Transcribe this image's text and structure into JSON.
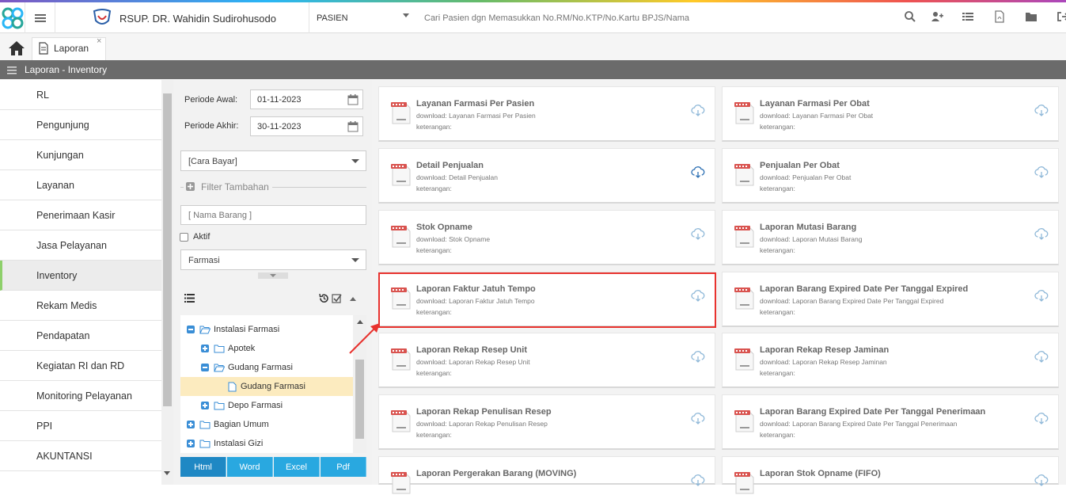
{
  "app": {
    "hospital_name": "RSUP. DR. Wahidin Sudirohusodo"
  },
  "search": {
    "category": "PASIEN",
    "placeholder": "Cari Pasien dgn Memasukkan No.RM/No.KTP/No.Kartu BPJS/Nama"
  },
  "tabs": [
    {
      "label": "Laporan",
      "close": "×"
    }
  ],
  "header": {
    "title": "Laporan - Inventory"
  },
  "sidebar": {
    "items": [
      {
        "label": "RL"
      },
      {
        "label": "Pengunjung"
      },
      {
        "label": "Kunjungan"
      },
      {
        "label": "Layanan"
      },
      {
        "label": "Penerimaan Kasir"
      },
      {
        "label": "Jasa Pelayanan"
      },
      {
        "label": "Inventory"
      },
      {
        "label": "Rekam Medis"
      },
      {
        "label": "Pendapatan"
      },
      {
        "label": "Kegiatan RI dan RD"
      },
      {
        "label": "Monitoring Pelayanan"
      },
      {
        "label": "PPI"
      },
      {
        "label": "AKUNTANSI"
      }
    ]
  },
  "filters": {
    "periode_awal_label": "Periode Awal:",
    "periode_awal_value": "01-11-2023",
    "periode_akhir_label": "Periode Akhir:",
    "periode_akhir_value": "30-11-2023",
    "cara_bayar": "[Cara Bayar]",
    "filter_tambahan": "Filter Tambahan",
    "nama_barang_placeholder": "[ Nama Barang ]",
    "aktif_label": "Aktif",
    "depo": "Farmasi"
  },
  "tree": [
    {
      "label": "Instalasi Farmasi"
    },
    {
      "label": "Apotek"
    },
    {
      "label": "Gudang Farmasi"
    },
    {
      "label": "Gudang Farmasi"
    },
    {
      "label": "Depo Farmasi"
    },
    {
      "label": "Bagian Umum"
    },
    {
      "label": "Instalasi Gizi"
    }
  ],
  "export_buttons": [
    {
      "label": "Html"
    },
    {
      "label": "Word"
    },
    {
      "label": "Excel"
    },
    {
      "label": "Pdf"
    }
  ],
  "reports": [
    {
      "title": "Layanan Farmasi Per Pasien",
      "download": "download: Layanan Farmasi Per Pasien",
      "ket": "keterangan:"
    },
    {
      "title": "Layanan Farmasi Per Obat",
      "download": "download: Layanan Farmasi Per Obat",
      "ket": "keterangan:"
    },
    {
      "title": "Detail Penjualan",
      "download": "download: Detail Penjualan",
      "ket": "keterangan:"
    },
    {
      "title": "Penjualan Per Obat",
      "download": "download: Penjualan Per Obat",
      "ket": "keterangan:"
    },
    {
      "title": "Stok Opname",
      "download": "download: Stok Opname",
      "ket": "keterangan:"
    },
    {
      "title": "Laporan Mutasi Barang",
      "download": "download: Laporan Mutasi Barang",
      "ket": "keterangan:"
    },
    {
      "title": "Laporan Faktur Jatuh Tempo",
      "download": "download: Laporan Faktur Jatuh Tempo",
      "ket": "keterangan:"
    },
    {
      "title": "Laporan Barang Expired Date Per Tanggal Expired",
      "download": "download: Laporan Barang Expired Date Per Tanggal Expired",
      "ket": "keterangan:"
    },
    {
      "title": "Laporan Rekap Resep Unit",
      "download": "download: Laporan Rekap Resep Unit",
      "ket": "keterangan:"
    },
    {
      "title": "Laporan Rekap Resep Jaminan",
      "download": "download: Laporan Rekap Resep Jaminan",
      "ket": "keterangan:"
    },
    {
      "title": "Laporan Rekap Penulisan Resep",
      "download": "download: Laporan Rekap Penulisan Resep",
      "ket": "keterangan:"
    },
    {
      "title": "Laporan Barang Expired Date Per Tanggal Penerimaan",
      "download": "download: Laporan Barang Expired Date Per Tanggal Penerimaan",
      "ket": "keterangan:"
    },
    {
      "title": "Laporan Pergerakan Barang (MOVING)",
      "download": "",
      "ket": ""
    },
    {
      "title": "Laporan Stok Opname (FIFO)",
      "download": "",
      "ket": ""
    }
  ],
  "colors": {
    "accent": "#29a8e0",
    "highlight": "#e8322e",
    "header": "#6b6b6b",
    "selected": "#fcebbf"
  },
  "icons": {
    "file": "pdf-file-icon",
    "download": "cloud-download-icon"
  }
}
